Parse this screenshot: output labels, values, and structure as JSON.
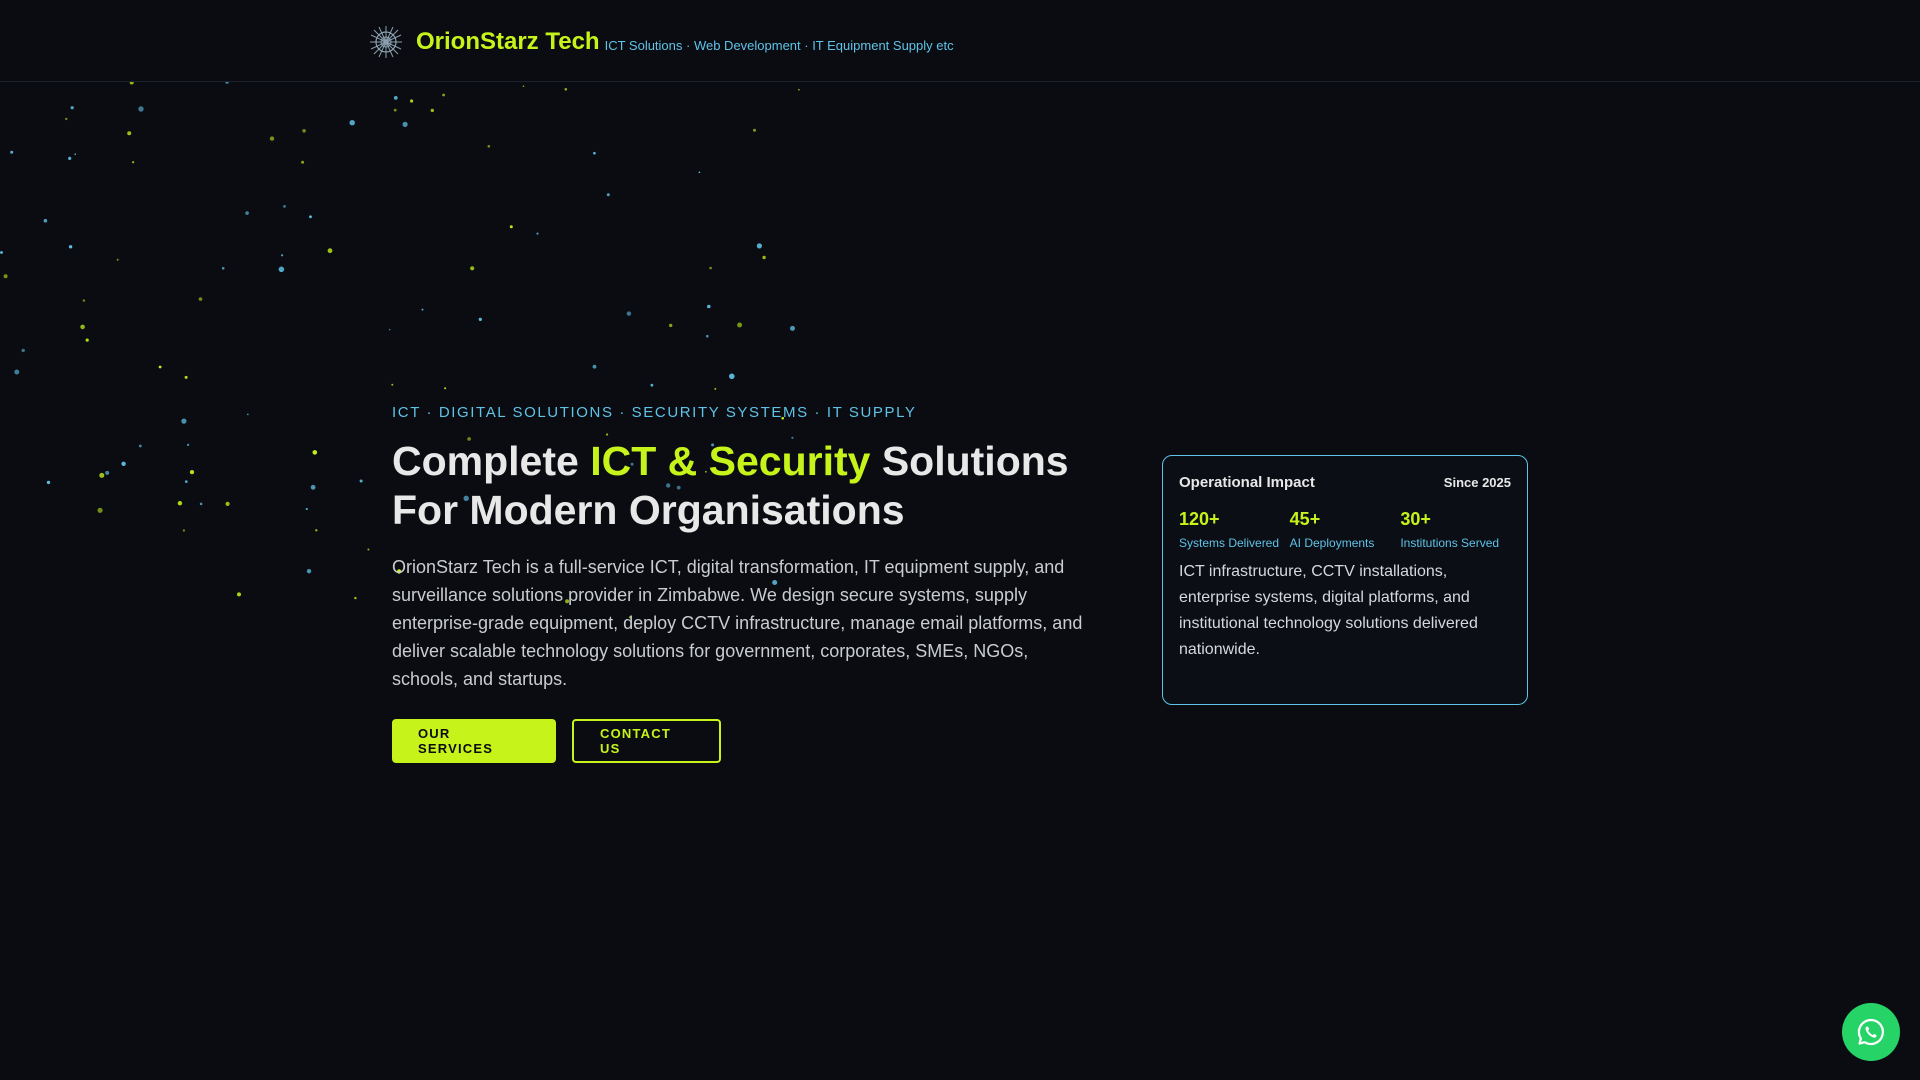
{
  "brand": {
    "name": "OrionStarz Tech",
    "tagline": "ICT Solutions · Web Development · IT Equipment Supply etc"
  },
  "hero": {
    "eyebrow": "ICT · DIGITAL SOLUTIONS · SECURITY SYSTEMS · IT SUPPLY",
    "headline_part1": "Complete ",
    "headline_accent": "ICT & Security",
    "headline_part2": " Solutions For Modern Organisations",
    "intro": "OrionStarz Tech is a full-service ICT, digital transformation, IT equipment supply, and surveillance solutions provider in Zimbabwe. We design secure systems, supply enterprise-grade equipment, deploy CCTV infrastructure, manage email platforms, and deliver scalable technology solutions for government, corporates, SMEs, NGOs, schools, and startups.",
    "primary_button": "OUR SERVICES",
    "secondary_button": "CONTACT US"
  },
  "impact_card": {
    "title": "Operational Impact",
    "since": "Since 2025",
    "stats": [
      {
        "value": "120+",
        "label": "Systems Delivered"
      },
      {
        "value": "45+",
        "label": "AI Deployments"
      },
      {
        "value": "30+",
        "label": "Institutions Served"
      }
    ],
    "description": "ICT infrastructure, CCTV installations, enterprise systems, digital platforms, and institutional technology solutions delivered nationwide."
  },
  "colors": {
    "background": "#0a0c11",
    "accent_lime": "#c6f41a",
    "accent_cyan": "#5fc3e8",
    "whatsapp_green": "#25d366"
  },
  "icons": {
    "logo": "orion-star-logo-icon",
    "chat": "whatsapp-icon"
  }
}
